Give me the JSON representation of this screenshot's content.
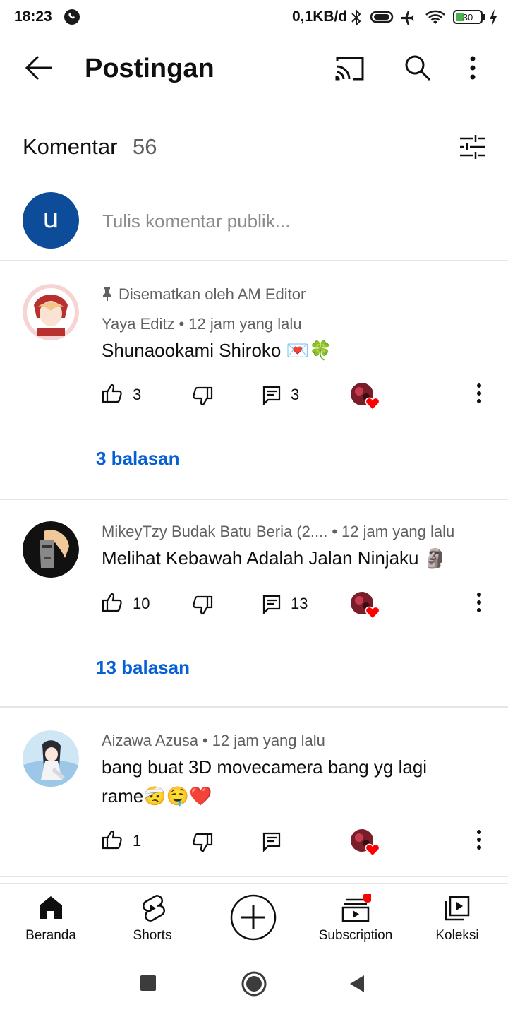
{
  "status_bar": {
    "time": "18:23",
    "net_speed": "0,1KB/d",
    "battery": "30"
  },
  "app_bar": {
    "title": "Postingan"
  },
  "comments": {
    "label": "Komentar",
    "count": "56",
    "input_placeholder": "Tulis komentar publik...",
    "user_initial": "u",
    "items": [
      {
        "pinned_label": "Disematkan oleh AM Editor",
        "author": "Yaya Editz",
        "time": "12 jam yang lalu",
        "text": "Shunaookami Shiroko 💌🍀",
        "likes": "3",
        "replies_count": "3",
        "replies_label": "3 balasan"
      },
      {
        "author": "MikeyTzy Budak Batu Beria (2....",
        "time": "12 jam yang lalu",
        "text": "Melihat Kebawah Adalah Jalan Ninjaku 🗿",
        "likes": "10",
        "replies_count": "13",
        "replies_label": "13 balasan"
      },
      {
        "author": "Aizawa Azusa",
        "time": "12 jam yang lalu",
        "text": "bang buat 3D movecamera bang yg lagi rame🤕🤤❤️",
        "likes": "1"
      }
    ]
  },
  "bottom_nav": {
    "items": [
      {
        "label": "Beranda",
        "icon": "home-icon"
      },
      {
        "label": "Shorts",
        "icon": "shorts-icon"
      },
      {
        "label": "",
        "icon": "create-icon"
      },
      {
        "label": "Subscription",
        "icon": "subscriptions-icon"
      },
      {
        "label": "Koleksi",
        "icon": "library-icon"
      }
    ]
  },
  "colors": {
    "link": "#065fd4",
    "secondary_text": "#606060",
    "avatar_user": "#0c4c98",
    "notification_dot": "#ff0000"
  }
}
